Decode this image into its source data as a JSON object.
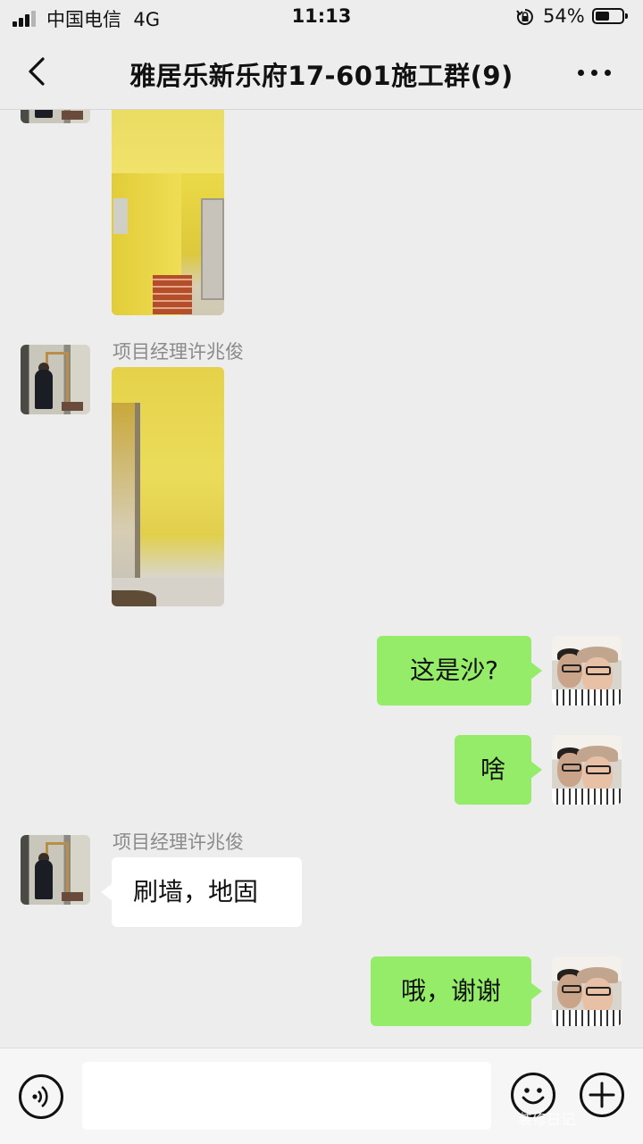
{
  "status_bar": {
    "carrier": "中国电信",
    "network": "4G",
    "time": "11:13",
    "battery_percent": "54%",
    "battery_level": 0.54
  },
  "header": {
    "title": "雅居乐新乐府17-601施工群(9)",
    "back_icon": "chevron-left-icon",
    "more_icon": "more-dots-icon"
  },
  "messages": [
    {
      "type": "image",
      "side": "left",
      "sender": "",
      "content": "yellow-wall-room-photo"
    },
    {
      "type": "image",
      "side": "left",
      "sender": "项目经理许兆俊",
      "content": "yellow-wall-corner-photo"
    },
    {
      "type": "text",
      "side": "right",
      "text": "这是沙?"
    },
    {
      "type": "text",
      "side": "right",
      "text": "啥"
    },
    {
      "type": "text",
      "side": "left",
      "sender": "项目经理许兆俊",
      "text": "刷墙，地固"
    },
    {
      "type": "text",
      "side": "right",
      "text": "哦，谢谢"
    }
  ],
  "input_bar": {
    "voice_icon": "voice-icon",
    "text_value": "",
    "emoji_icon": "emoji-icon",
    "plus_icon": "plus-icon"
  },
  "watermark": "装修日记",
  "colors": {
    "background": "#ededed",
    "my_bubble": "#95ec69",
    "their_bubble": "#ffffff",
    "sender_name": "#8a8a8a"
  }
}
